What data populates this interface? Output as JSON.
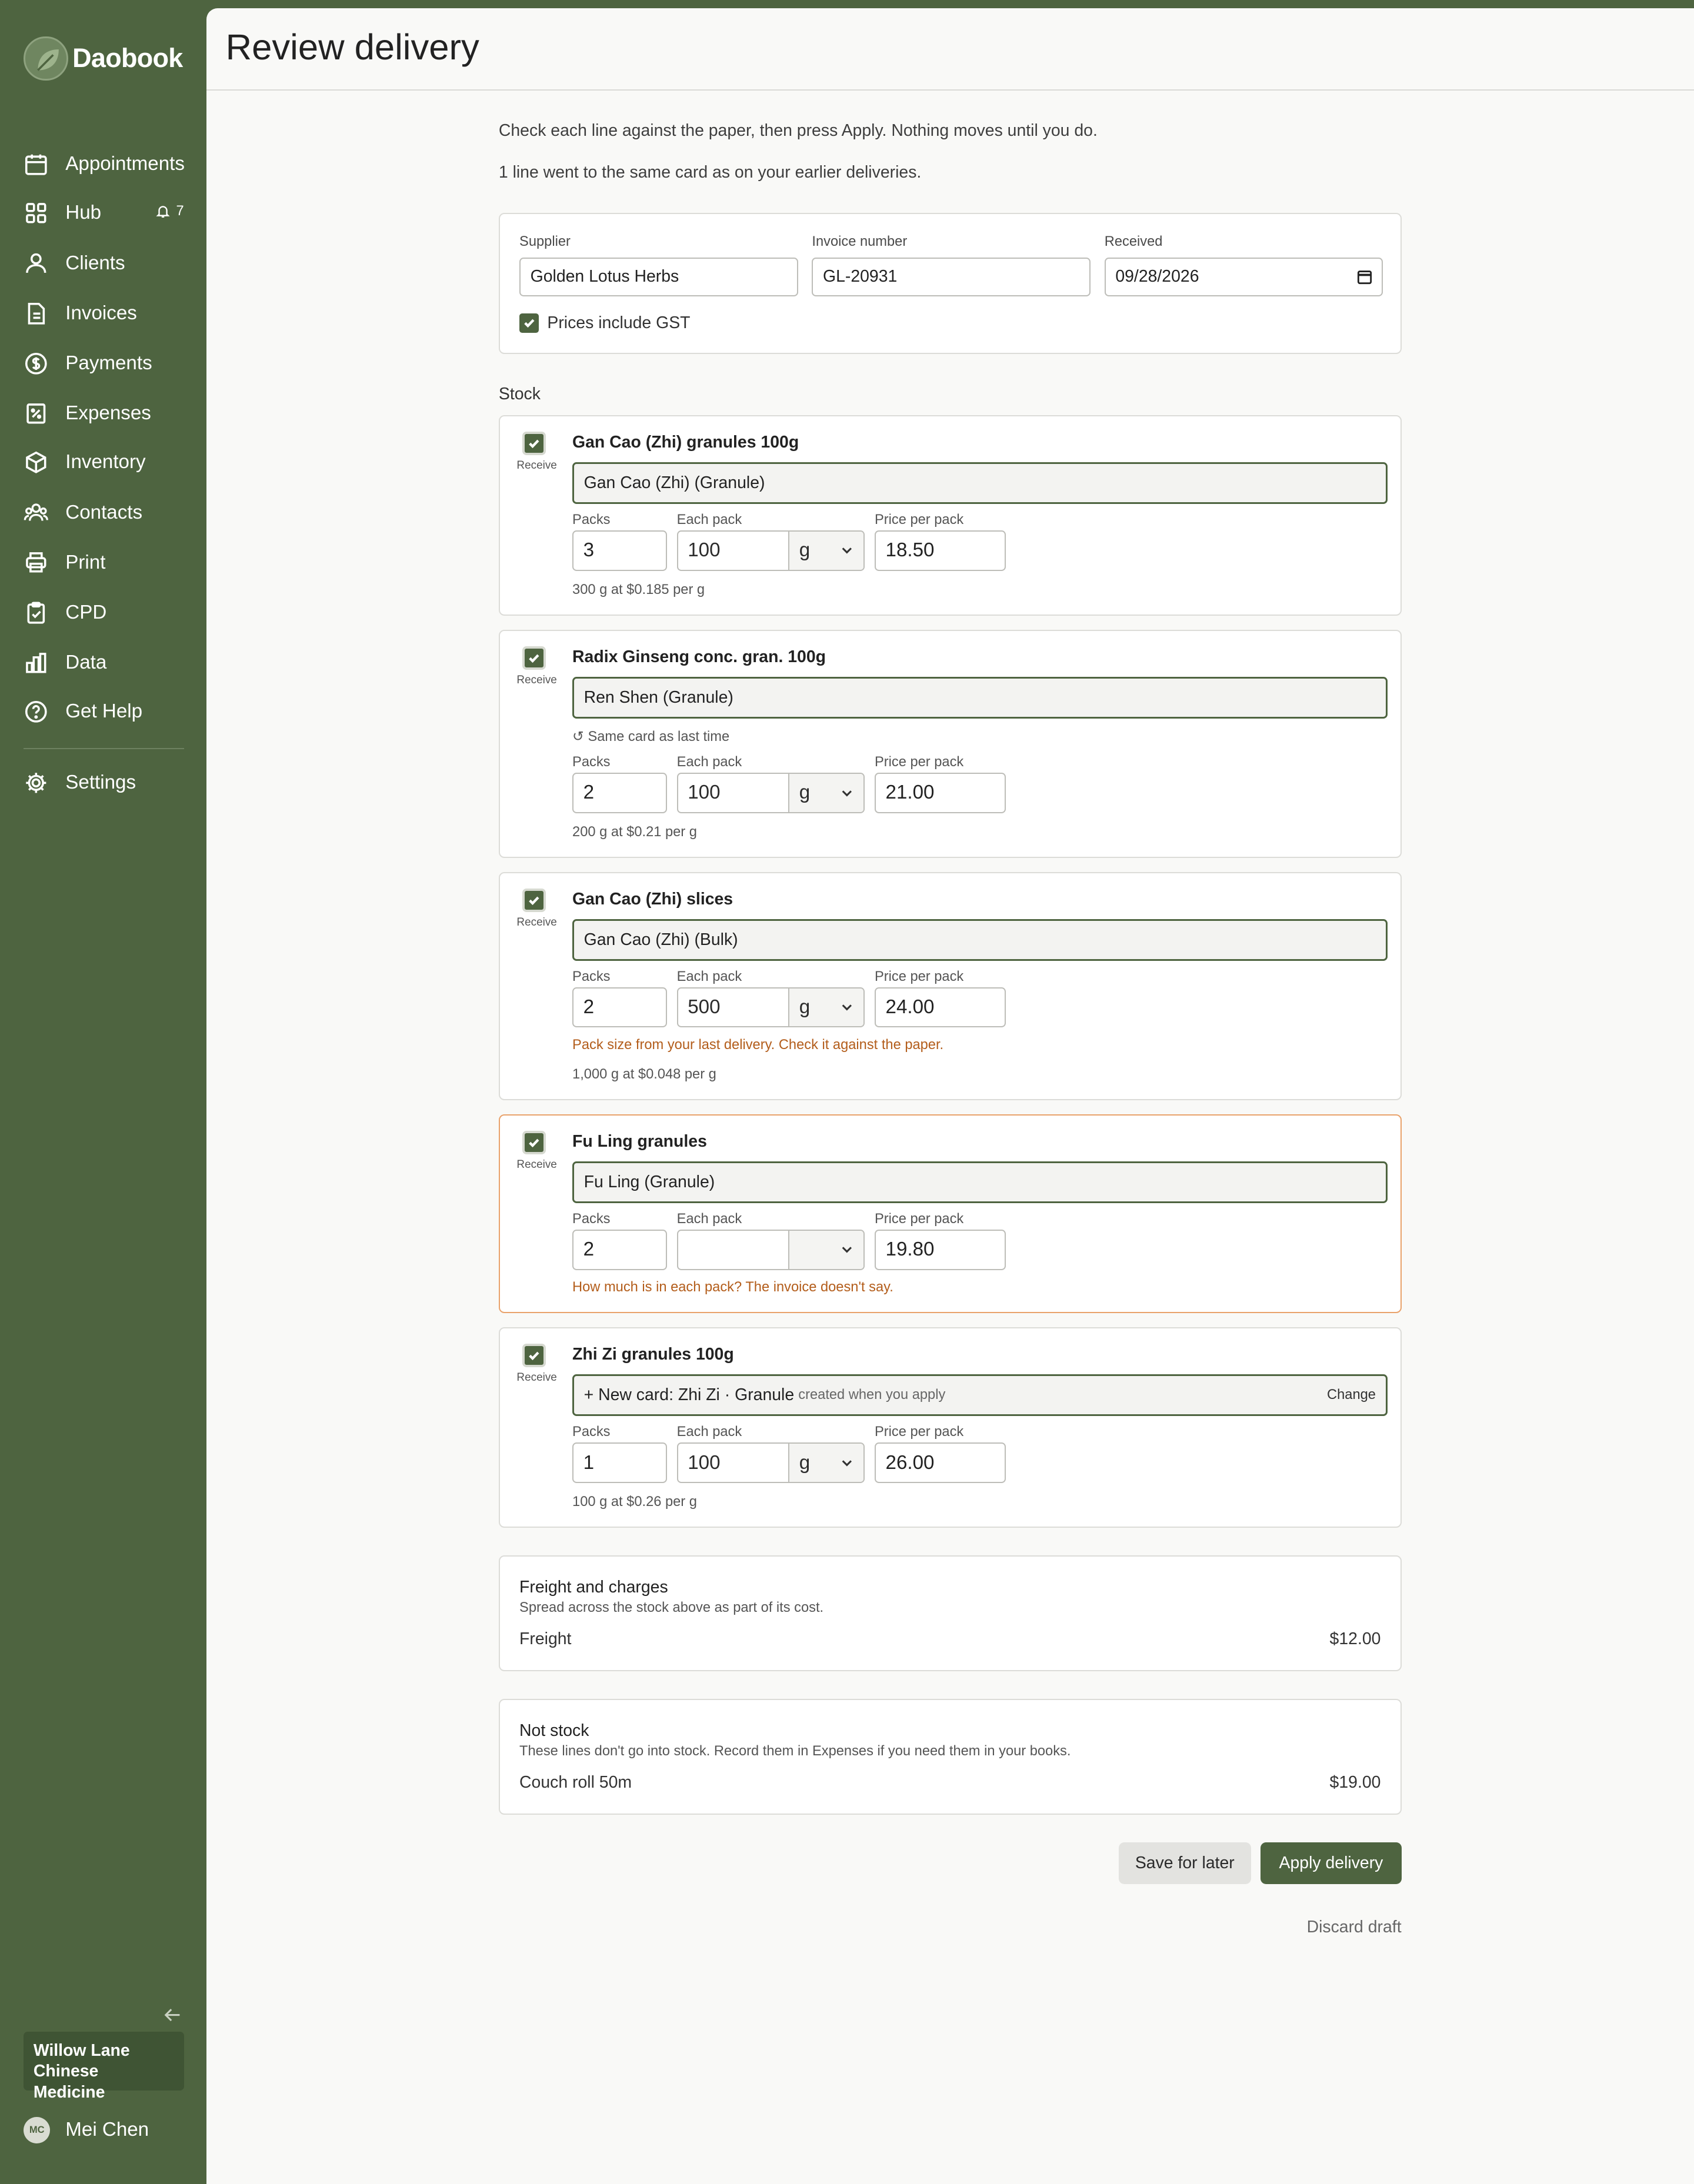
{
  "brand": {
    "name": "Daobook"
  },
  "sidebar": {
    "items": [
      {
        "label": "Appointments",
        "icon": "calendar-icon"
      },
      {
        "label": "Hub",
        "icon": "grid-icon",
        "badge": "7"
      },
      {
        "label": "Clients",
        "icon": "users-icon"
      },
      {
        "label": "Invoices",
        "icon": "file-icon"
      },
      {
        "label": "Payments",
        "icon": "dollar-icon"
      },
      {
        "label": "Expenses",
        "icon": "receipt-icon"
      },
      {
        "label": "Inventory",
        "icon": "box-icon"
      },
      {
        "label": "Contacts",
        "icon": "contacts-icon"
      },
      {
        "label": "Print",
        "icon": "printer-icon"
      },
      {
        "label": "CPD",
        "icon": "clipboard-icon"
      },
      {
        "label": "Data",
        "icon": "bar-chart-icon"
      },
      {
        "label": "Get Help",
        "icon": "help-icon"
      },
      {
        "label": "Settings",
        "icon": "gear-icon"
      }
    ],
    "clinic_name": "Willow Lane Chinese Medicine",
    "user_initials": "MC",
    "user_name": "Mei Chen"
  },
  "page": {
    "title": "Review delivery",
    "intro1": "Check each line against the paper, then press Apply. Nothing moves until you do.",
    "intro2": "1 line went to the same card as on your earlier deliveries."
  },
  "invoice": {
    "supplier_label": "Supplier",
    "supplier": "Golden Lotus Herbs",
    "invoice_label": "Invoice number",
    "invoice_number": "GL-20931",
    "received_label": "Received",
    "received": "09/28/2026",
    "gst_label": "Prices include GST",
    "gst_checked": true
  },
  "stock": {
    "section_label": "Stock",
    "receive_label": "Receive",
    "packs_label": "Packs",
    "each_label": "Each pack",
    "price_label": "Price per pack",
    "lines": [
      {
        "name": "Gan Cao (Zhi) granules 100g",
        "matched": "Gan Cao (Zhi) (Granule)",
        "packs": "3",
        "each": "100",
        "unit": "g",
        "price": "18.50",
        "summary": "300 g at $0.185 per g"
      },
      {
        "name": "Radix Ginseng conc. gran. 100g",
        "matched": "Ren Shen (Granule)",
        "same_note": "↺ Same card as last time",
        "packs": "2",
        "each": "100",
        "unit": "g",
        "price": "21.00",
        "summary": "200 g at $0.21 per g"
      },
      {
        "name": "Gan Cao (Zhi) slices",
        "matched": "Gan Cao (Zhi) (Bulk)",
        "packs": "2",
        "each": "500",
        "unit": "g",
        "price": "24.00",
        "warning": "Pack size from your last delivery. Check it against the paper.",
        "summary": "1,000 g at $0.048 per g"
      },
      {
        "name": "Fu Ling granules",
        "matched": "Fu Ling (Granule)",
        "packs": "2",
        "each": "",
        "unit": "",
        "price": "19.80",
        "warning": "How much is in each pack? The invoice doesn't say."
      },
      {
        "name": "Zhi Zi granules 100g",
        "matched": "+ New card: Zhi Zi · Granule",
        "matched_suffix": "created when you apply",
        "change": "Change",
        "packs": "1",
        "each": "100",
        "unit": "g",
        "price": "26.00",
        "summary": "100 g at $0.26 per g"
      }
    ]
  },
  "freight": {
    "title": "Freight and charges",
    "subtitle": "Spread across the stock above as part of its cost.",
    "label": "Freight",
    "amount": "$12.00"
  },
  "not_stock": {
    "title": "Not stock",
    "subtitle": "These lines don't go into stock. Record them in Expenses if you need them in your books.",
    "label": "Couch roll 50m",
    "amount": "$19.00"
  },
  "actions": {
    "save": "Save for later",
    "apply": "Apply delivery",
    "discard": "Discard draft"
  },
  "colors": {
    "sidebar": "#4e6440",
    "accent": "#4e6440",
    "warning": "#b35d1b",
    "warning_border": "#e9a26b",
    "background": "#f9f9f7"
  }
}
